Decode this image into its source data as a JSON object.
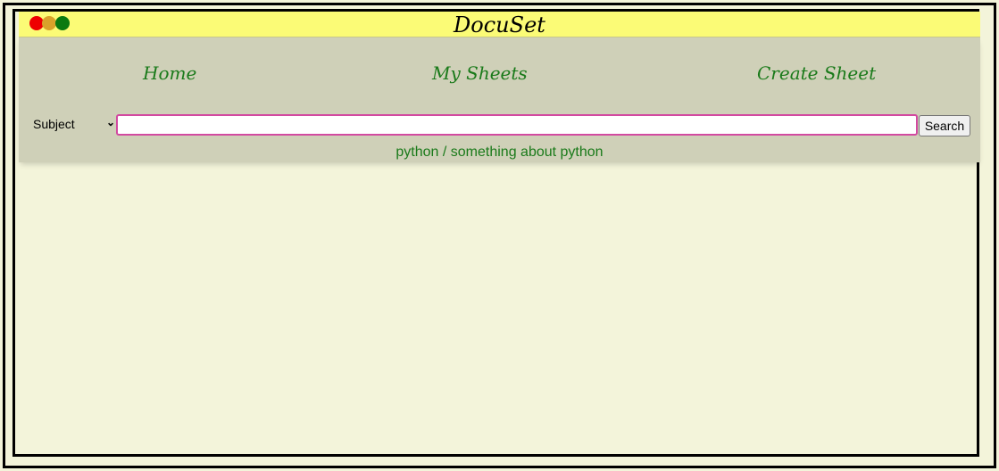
{
  "window": {
    "title": "DocuSet",
    "controls": [
      "close-icon",
      "minimize-icon",
      "maximize-icon"
    ],
    "colors": {
      "close": "#ee0000",
      "minimize": "#d9a22a",
      "maximize": "#0a7a10"
    }
  },
  "nav": {
    "items": [
      {
        "label": "Home"
      },
      {
        "label": "My Sheets"
      },
      {
        "label": "Create Sheet"
      }
    ]
  },
  "search": {
    "filter": {
      "selected": "Subject",
      "icon": "chevron-down-icon"
    },
    "query": "",
    "button_label": "Search"
  },
  "results": [
    {
      "label": "python / something about python"
    }
  ],
  "theme": {
    "background": "#f3f4da",
    "titlebar": "#fbfb76",
    "navbar": "#cfd0b8",
    "link": "#1a7a1a",
    "input_border": "#d24aa0"
  }
}
